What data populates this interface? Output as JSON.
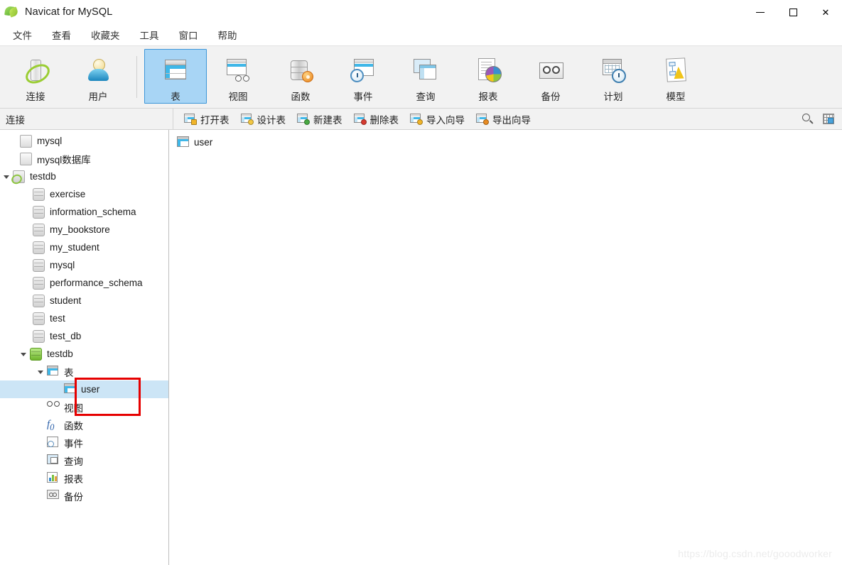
{
  "window": {
    "title": "Navicat for MySQL",
    "app_icon": "navicat-logo",
    "controls": {
      "minimize": "minimize-icon",
      "maximize": "maximize-icon",
      "close": "close-icon"
    }
  },
  "menubar": {
    "items": [
      {
        "label": "文件"
      },
      {
        "label": "查看"
      },
      {
        "label": "收藏夹"
      },
      {
        "label": "工具"
      },
      {
        "label": "窗口"
      },
      {
        "label": "帮助"
      }
    ]
  },
  "toolbar": {
    "groups": [
      {
        "buttons": [
          {
            "label": "连接",
            "icon": "connection-icon",
            "selected": false
          },
          {
            "label": "用户",
            "icon": "user-icon",
            "selected": false
          }
        ]
      },
      {
        "buttons": [
          {
            "label": "表",
            "icon": "table-icon",
            "selected": true
          },
          {
            "label": "视图",
            "icon": "view-icon",
            "selected": false
          },
          {
            "label": "函数",
            "icon": "function-icon",
            "selected": false
          },
          {
            "label": "事件",
            "icon": "event-icon",
            "selected": false
          },
          {
            "label": "查询",
            "icon": "query-icon",
            "selected": false
          },
          {
            "label": "报表",
            "icon": "report-icon",
            "selected": false
          },
          {
            "label": "备份",
            "icon": "backup-icon",
            "selected": false
          },
          {
            "label": "计划",
            "icon": "schedule-icon",
            "selected": false
          },
          {
            "label": "模型",
            "icon": "model-icon",
            "selected": false
          }
        ]
      }
    ]
  },
  "connection_panel": {
    "header": "连接"
  },
  "table_toolbar": {
    "buttons": [
      {
        "label": "打开表",
        "icon": "open-table-icon",
        "badge": "gold"
      },
      {
        "label": "设计表",
        "icon": "design-table-icon",
        "badge": "pencil"
      },
      {
        "label": "新建表",
        "icon": "new-table-icon",
        "badge": "green"
      },
      {
        "label": "删除表",
        "icon": "delete-table-icon",
        "badge": "red"
      },
      {
        "label": "导入向导",
        "icon": "import-wizard-icon",
        "badge": "gold"
      },
      {
        "label": "导出向导",
        "icon": "export-wizard-icon",
        "badge": "orange"
      }
    ],
    "right_icons": [
      {
        "name": "search-icon"
      },
      {
        "name": "grid-view-icon"
      }
    ]
  },
  "tree": {
    "items": [
      {
        "label": "mysql",
        "icon": "connection-grey-icon",
        "indent": 1,
        "expander": "none",
        "selected": false
      },
      {
        "label": "mysql数据库",
        "icon": "connection-grey-icon",
        "indent": 1,
        "expander": "none",
        "selected": false
      },
      {
        "label": "testdb",
        "icon": "connection-green-icon",
        "indent": 0,
        "expander": "expanded",
        "selected": false
      },
      {
        "label": "exercise",
        "icon": "database-grey-icon",
        "indent": 2,
        "expander": "none",
        "selected": false
      },
      {
        "label": "information_schema",
        "icon": "database-grey-icon",
        "indent": 2,
        "expander": "none",
        "selected": false
      },
      {
        "label": "my_bookstore",
        "icon": "database-grey-icon",
        "indent": 2,
        "expander": "none",
        "selected": false
      },
      {
        "label": "my_student",
        "icon": "database-grey-icon",
        "indent": 2,
        "expander": "none",
        "selected": false
      },
      {
        "label": "mysql",
        "icon": "database-grey-icon",
        "indent": 2,
        "expander": "none",
        "selected": false
      },
      {
        "label": "performance_schema",
        "icon": "database-grey-icon",
        "indent": 2,
        "expander": "none",
        "selected": false
      },
      {
        "label": "student",
        "icon": "database-grey-icon",
        "indent": 2,
        "expander": "none",
        "selected": false
      },
      {
        "label": "test",
        "icon": "database-grey-icon",
        "indent": 2,
        "expander": "none",
        "selected": false
      },
      {
        "label": "test_db",
        "icon": "database-grey-icon",
        "indent": 2,
        "expander": "none",
        "selected": false
      },
      {
        "label": "testdb",
        "icon": "database-green-icon",
        "indent": 1,
        "expander": "expanded",
        "selected": false
      },
      {
        "label": "表",
        "icon": "table-icon",
        "indent": 2,
        "expander": "expanded",
        "selected": false
      },
      {
        "label": "user",
        "icon": "table-icon",
        "indent": 4,
        "expander": "none",
        "selected": true
      },
      {
        "label": "视图",
        "icon": "view-glasses-icon",
        "indent": 3,
        "expander": "none",
        "selected": false
      },
      {
        "label": "函数",
        "icon": "function-fx-icon",
        "indent": 3,
        "expander": "none",
        "selected": false
      },
      {
        "label": "事件",
        "icon": "event-clock-icon",
        "indent": 3,
        "expander": "none",
        "selected": false
      },
      {
        "label": "查询",
        "icon": "query-windows-icon",
        "indent": 3,
        "expander": "none",
        "selected": false
      },
      {
        "label": "报表",
        "icon": "report-chart-icon",
        "indent": 3,
        "expander": "none",
        "selected": false
      },
      {
        "label": "备份",
        "icon": "backup-tape-icon",
        "indent": 3,
        "expander": "none",
        "selected": false
      }
    ]
  },
  "content": {
    "objects": [
      {
        "label": "user",
        "icon": "table-icon"
      }
    ]
  },
  "watermark": {
    "text": "https://blog.csdn.net/gooodworker"
  },
  "annotation": {
    "type": "rectangle",
    "color": "#e60000"
  }
}
